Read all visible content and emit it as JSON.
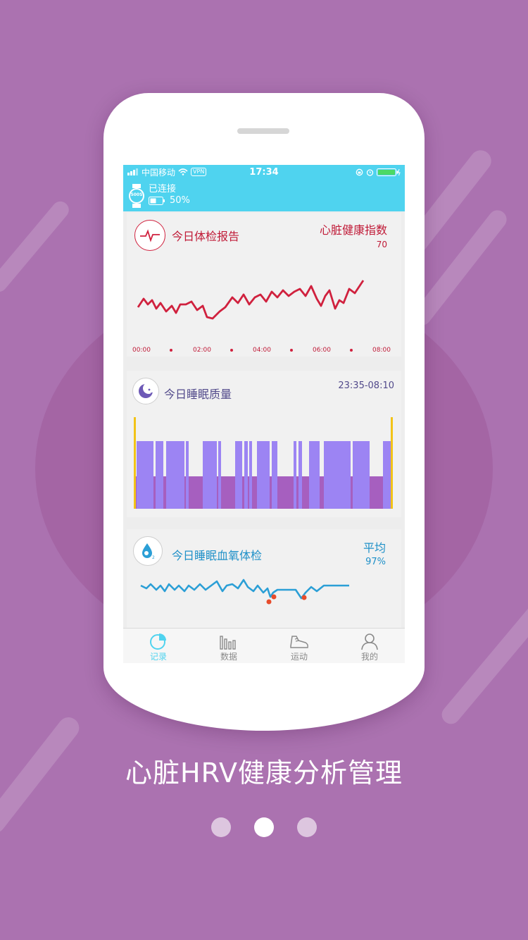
{
  "status_bar": {
    "carrier": "中国移动",
    "vpn": "VPN",
    "time": "17:34"
  },
  "device": {
    "connection": "已连接",
    "battery": "50%",
    "watch_label": "500S"
  },
  "heart_card": {
    "title": "今日体检报告",
    "index_label": "心脏健康指数",
    "index_value": "70",
    "x_ticks": [
      "00:00",
      "02:00",
      "04:00",
      "06:00",
      "08:00"
    ]
  },
  "sleep_card": {
    "title": "今日睡眠质量",
    "range": "23:35-08:10"
  },
  "oxygen_card": {
    "title": "今日睡眠血氧体检",
    "avg_label": "平均",
    "avg_value": "97%"
  },
  "tabs": [
    {
      "label": "记录",
      "icon": "pie-chart-icon"
    },
    {
      "label": "数据",
      "icon": "bar-chart-icon"
    },
    {
      "label": "运动",
      "icon": "sneaker-icon"
    },
    {
      "label": "我的",
      "icon": "person-icon"
    }
  ],
  "tagline": "心脏HRV健康分析管理",
  "pager": {
    "count": 3,
    "active": 2
  },
  "colors": {
    "background": "#ab72b0",
    "accent": "#4fd3ef",
    "heart": "#d0213e",
    "sleep_deep": "#9c84f3",
    "sleep_light": "#a65fbf",
    "oxygen": "#2b9fd6"
  }
}
